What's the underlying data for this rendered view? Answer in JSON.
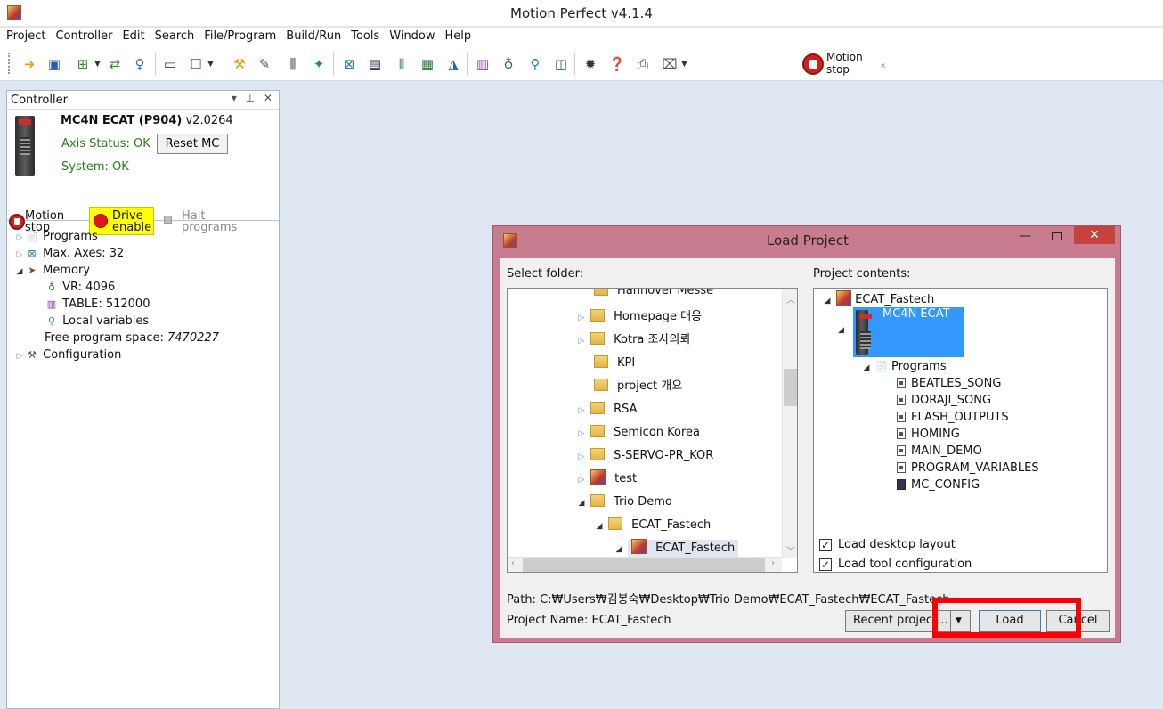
{
  "app": {
    "title": "Motion Perfect v4.1.4"
  },
  "menu": [
    "Project",
    "Controller",
    "Edit",
    "Search",
    "File/Program",
    "Build/Run",
    "Tools",
    "Window",
    "Help"
  ],
  "toolbar": {
    "motion_stop_line1": "Motion",
    "motion_stop_line2": "stop"
  },
  "controller_panel": {
    "title": "Controller",
    "controls": "▾ ⊥ ✕",
    "controller_name": "MC4N ECAT (P904)",
    "version": "v2.0264",
    "axis_status": "Axis Status: OK",
    "reset_button": "Reset MC",
    "system_status": "System: OK",
    "motion_stop_line1": "Motion",
    "motion_stop_line2": "stop",
    "drive_enable_line1": "Drive",
    "drive_enable_line2": "enable",
    "halt_line1": "Halt",
    "halt_line2": "programs",
    "tree": {
      "programs": "Programs",
      "max_axes": "Max. Axes: 32",
      "memory": "Memory",
      "vr": "VR: 4096",
      "table": "TABLE: 512000",
      "local_vars": "Local variables",
      "free_space_label": "Free program space:",
      "free_space_value": "7470227",
      "configuration": "Configuration"
    }
  },
  "dialog": {
    "title": "Load Project",
    "select_folder_label": "Select folder:",
    "project_contents_label": "Project contents:",
    "folders": [
      "Hannover Messe",
      "Homepage 대응",
      "Kotra 조사의뢰",
      "KPI",
      "project 개요",
      "RSA",
      "Semicon Korea",
      "S-SERVO-PR_KOR",
      "test",
      "Trio Demo",
      "ECAT_Fastech",
      "ECAT_Fastech"
    ],
    "contents": {
      "root": "ECAT_Fastech",
      "controller": "MC4N ECAT",
      "programs": "Programs",
      "program_list": [
        "BEATLES_SONG",
        "DORAJI_SONG",
        "FLASH_OUTPUTS",
        "HOMING",
        "MAIN_DEMO",
        "PROGRAM_VARIABLES",
        "MC_CONFIG"
      ]
    },
    "load_desktop_layout": "Load desktop layout",
    "load_tool_config": "Load tool configuration",
    "path": "Path:  C:₩Users₩김봉숙₩Desktop₩Trio Demo₩ECAT_Fastech₩ECAT_Fastech",
    "project_name": "Project Name:  ECAT_Fastech",
    "recent_button": "Recent project...",
    "load_button": "Load",
    "cancel_button": "Cancel"
  },
  "colors": {
    "highlight": "#ff0000",
    "dialog_frame": "#c97b90",
    "close_button": "#c7423d",
    "drive_enable": "#ffff00"
  }
}
